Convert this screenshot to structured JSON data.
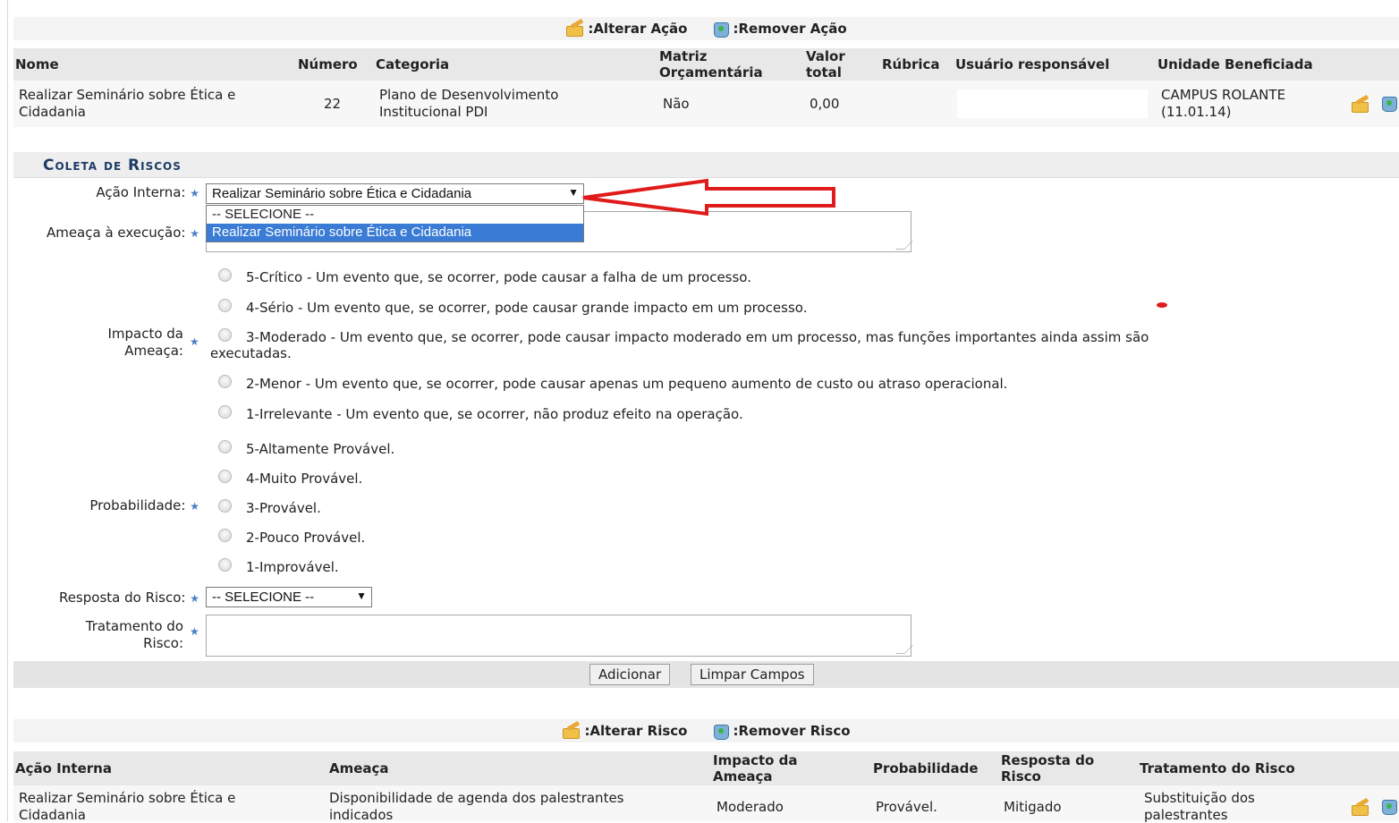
{
  "legend_acao": {
    "alterar": ":Alterar Ação",
    "remover": ":Remover Ação"
  },
  "acoes_table": {
    "headers": {
      "nome": "Nome",
      "numero": "Número",
      "categoria": "Categoria",
      "matriz_1": "Matriz",
      "matriz_2": "Orçamentária",
      "valor_1": "Valor",
      "valor_2": "total",
      "rubrica": "Rúbrica",
      "usuario": "Usuário responsável",
      "unidade": "Unidade Beneficiada"
    },
    "row": {
      "nome_1": "Realizar Seminário sobre Ética e",
      "nome_2": "Cidadania",
      "numero": "22",
      "categoria_1": "Plano de Desenvolvimento",
      "categoria_2": "Institucional PDI",
      "matriz": "Não",
      "valor": "0,00",
      "unidade_1": "CAMPUS ROLANTE",
      "unidade_2": "(11.01.14)"
    }
  },
  "section": {
    "title": "Coleta de Riscos"
  },
  "form": {
    "acao_interna": {
      "label": "Ação Interna:",
      "selected": "Realizar Seminário sobre Ética e Cidadania",
      "arrow": "▼",
      "options": [
        "-- SELECIONE --",
        "Realizar Seminário sobre Ética e Cidadania"
      ]
    },
    "ameaca": {
      "label": "Ameaça à execução:"
    },
    "impacto": {
      "label_1": "Impacto da",
      "label_2": "Ameaça:",
      "options": [
        "5-Crítico - Um evento que, se ocorrer, pode causar a falha de um processo.",
        "4-Sério - Um evento que, se ocorrer, pode causar grande impacto em um processo.",
        "3-Moderado - Um evento que, se ocorrer, pode causar impacto moderado em um processo, mas funções importantes ainda assim são",
        "2-Menor - Um evento que, se ocorrer, pode causar apenas um pequeno aumento de custo ou atraso operacional.",
        "1-Irrelevante - Um evento que, se ocorrer, não produz efeito na operação."
      ],
      "option_3_cont": "executadas."
    },
    "probabilidade": {
      "label": "Probabilidade:",
      "options": [
        "5-Altamente Provável.",
        "4-Muito Provável.",
        "3-Provável.",
        "2-Pouco Provável.",
        "1-Improvável."
      ]
    },
    "resposta": {
      "label": "Resposta do Risco:",
      "selected": "-- SELECIONE --",
      "arrow": "▼"
    },
    "tratamento": {
      "label_1": "Tratamento do",
      "label_2": "Risco:"
    },
    "required_mark": "★",
    "buttons": {
      "adicionar": "Adicionar",
      "limpar": "Limpar Campos"
    }
  },
  "legend_risco": {
    "alterar": ":Alterar Risco",
    "remover": ":Remover Risco"
  },
  "riscos_table": {
    "headers": {
      "acao": "Ação Interna",
      "ameaca": "Ameaça",
      "impacto_1": "Impacto da",
      "impacto_2": "Ameaça",
      "probabilidade": "Probabilidade",
      "resposta_1": "Resposta do",
      "resposta_2": "Risco",
      "tratamento": "Tratamento do Risco"
    },
    "row": {
      "acao_1": "Realizar Seminário sobre Ética e",
      "acao_2": "Cidadania",
      "ameaca_1": "Disponibilidade de agenda dos palestrantes",
      "ameaca_2": "indicados",
      "impacto": "Moderado",
      "probabilidade": "Provável.",
      "resposta": "Mitigado",
      "tratamento_1": "Substituição dos",
      "tratamento_2": "palestrantes"
    }
  },
  "colors": {
    "section_title": "#1d3b64",
    "required": "#4a80c6",
    "highlight": "#3a7bd5",
    "annotation_arrow": "#e01b1b"
  },
  "icons": [
    "pencil-icon",
    "trash-icon",
    "required-star-icon",
    "dropdown-arrow-icon",
    "annotation-arrow"
  ]
}
